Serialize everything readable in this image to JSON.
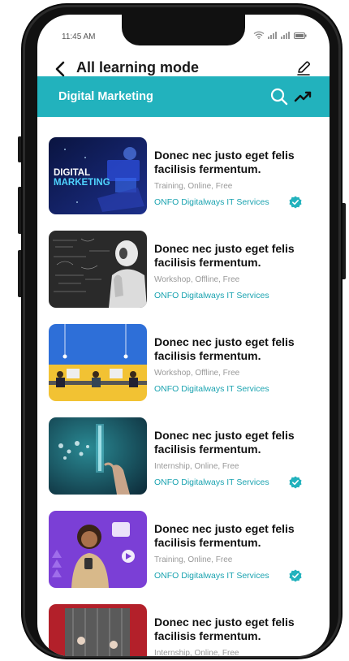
{
  "status_bar": {
    "time": "11:45 AM",
    "icons": [
      "wifi-icon",
      "signal-icon",
      "signal-icon",
      "battery-icon"
    ]
  },
  "header": {
    "back_icon": "chevron-left-icon",
    "title": "All learning mode",
    "edit_icon": "pencil-icon"
  },
  "category_bar": {
    "title": "Digital Marketing",
    "search_icon": "search-icon",
    "trend_icon": "trending-up-icon"
  },
  "colors": {
    "accent": "#22b2bd",
    "provider_text": "#1aa3b0",
    "verified_badge": "#22b2bd"
  },
  "courses": [
    {
      "title": "Donec nec justo eget felis facilisis fermentum.",
      "meta": "Training, Online, Free",
      "provider": "ONFO Digitalways IT Services",
      "verified": true,
      "thumb_line1": "DIGITAL",
      "thumb_line2": "MARKETING"
    },
    {
      "title": "Donec nec justo eget felis facilisis fermentum.",
      "meta": "Workshop, Offline, Free",
      "provider": "ONFO Digitalways IT Services",
      "verified": false
    },
    {
      "title": "Donec nec justo eget felis facilisis fermentum.",
      "meta": "Workshop, Offline, Free",
      "provider": "ONFO Digitalways IT Services",
      "verified": false
    },
    {
      "title": "Donec nec justo eget felis facilisis fermentum.",
      "meta": "Internship, Online, Free",
      "provider": "ONFO Digitalways IT Services",
      "verified": true
    },
    {
      "title": "Donec nec justo eget felis facilisis fermentum.",
      "meta": "Training, Online, Free",
      "provider": "ONFO Digitalways IT Services",
      "verified": true
    },
    {
      "title": "Donec nec justo eget felis facilisis fermentum.",
      "meta": "Internship, Online, Free",
      "provider": "",
      "verified": false
    }
  ]
}
